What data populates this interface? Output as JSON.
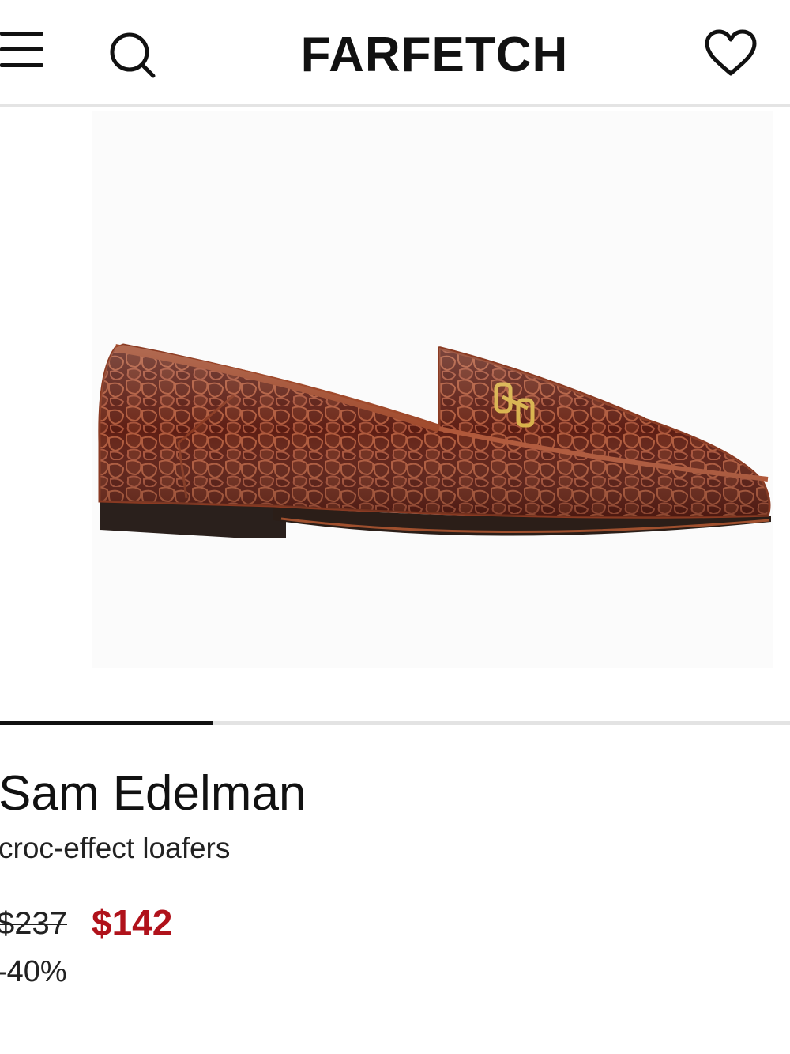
{
  "header": {
    "logo": "FARFETCH",
    "menu_icon": "hamburger-menu-icon",
    "search_icon": "search-icon",
    "wishlist_icon": "heart-icon"
  },
  "gallery": {
    "image_alt": "croc-effect loafers",
    "progress_fraction": 0.27
  },
  "product": {
    "brand": "Sam Edelman",
    "name": "croc-effect loafers",
    "original_price": "$237",
    "sale_price": "$142",
    "discount": "-40%"
  },
  "colors": {
    "sale_red": "#b0121b",
    "leather": "#6e2416",
    "sole": "#222222"
  }
}
